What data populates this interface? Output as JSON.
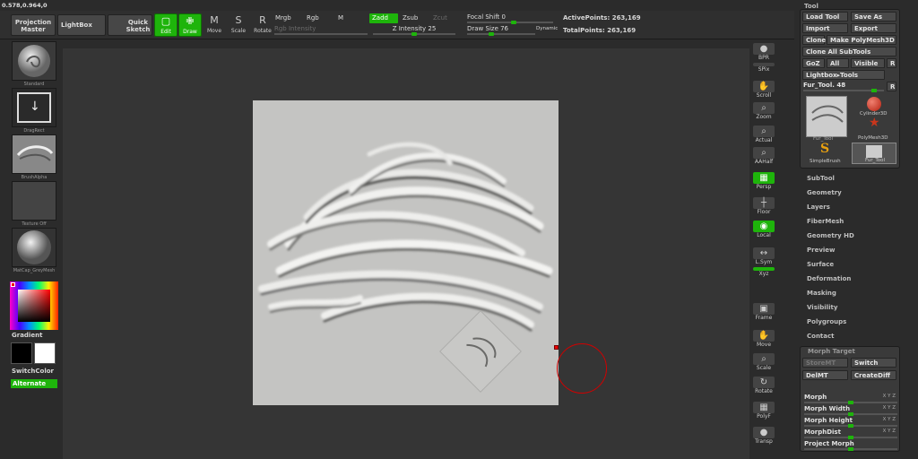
{
  "coords": "0.578,0.964,0",
  "topbar": {
    "projection_master": "Projection Master",
    "lightbox": "LightBox",
    "quick_sketch": "Quick Sketch",
    "tools": [
      {
        "id": "edit",
        "label": "Edit",
        "icon": "▢",
        "active": true
      },
      {
        "id": "draw",
        "label": "Draw",
        "icon": "✙",
        "active": true
      },
      {
        "id": "move",
        "label": "Move",
        "icon": "M",
        "active": false
      },
      {
        "id": "scale",
        "label": "Scale",
        "icon": "S",
        "active": false
      },
      {
        "id": "rotate",
        "label": "Rotate",
        "icon": "R",
        "active": false
      }
    ],
    "mrgb": "Mrgb",
    "rgb": "Rgb",
    "m": "M",
    "rgb_intensity": "Rgb Intensity",
    "zadd": "Zadd",
    "zsub": "Zsub",
    "zcut": "Zcut",
    "z_intensity": "Z Intensity 25",
    "z_intensity_value": 0.25,
    "focal_shift": "Focal Shift 0",
    "focal_shift_value": 0.5,
    "draw_size": "Draw Size 76",
    "draw_size_value": 0.25,
    "dynamic": "Dynamic",
    "active_points": "ActivePoints: 263,169",
    "total_points": "TotalPoints: 263,169"
  },
  "left": {
    "standard": "Standard",
    "dragrect": "DragRect",
    "brushalpha": "BrushAlpha",
    "texture_off": "Texture Off",
    "matcap": "MatCap_GreyMesh",
    "gradient": "Gradient",
    "switch_color": "SwitchColor",
    "alternate": "Alternate"
  },
  "right_shelf": [
    {
      "id": "bpr",
      "label": "BPR",
      "icon": "●",
      "active": false
    },
    {
      "id": "spix",
      "label": "SPix",
      "icon": "",
      "active": false
    },
    {
      "id": "scroll",
      "label": "Scroll",
      "icon": "✋",
      "active": false
    },
    {
      "id": "zoom",
      "label": "Zoom",
      "icon": "⌕",
      "active": false
    },
    {
      "id": "actual",
      "label": "Actual",
      "icon": "⌕",
      "active": false
    },
    {
      "id": "aahalf",
      "label": "AAHalf",
      "icon": "⌕",
      "active": false
    },
    {
      "id": "persp",
      "label": "Persp",
      "icon": "▦",
      "active": true
    },
    {
      "id": "floor",
      "label": "Floor",
      "icon": "┼",
      "active": false
    },
    {
      "id": "local",
      "label": "Local",
      "icon": "◉",
      "active": true
    },
    {
      "id": "lsym",
      "label": "L.Sym",
      "icon": "↔",
      "active": false
    },
    {
      "id": "xyz",
      "label": "Xyz",
      "icon": "",
      "active": true
    },
    {
      "id": "frame",
      "label": "Frame",
      "icon": "▣",
      "active": false
    },
    {
      "id": "move",
      "label": "Move",
      "icon": "✋",
      "active": false
    },
    {
      "id": "scale",
      "label": "Scale",
      "icon": "⌕",
      "active": false
    },
    {
      "id": "rotate",
      "label": "Rotate",
      "icon": "↻",
      "active": false
    },
    {
      "id": "polyf",
      "label": "PolyF",
      "icon": "▦",
      "active": false
    },
    {
      "id": "transp",
      "label": "Transp",
      "icon": "●",
      "active": false
    }
  ],
  "tool_palette": {
    "title": "Tool",
    "load_tool": "Load Tool",
    "save_as": "Save As",
    "import": "Import",
    "export": "Export",
    "clone": "Clone",
    "make_polymesh": "Make PolyMesh3D",
    "clone_all": "Clone All SubTools",
    "goz": "GoZ",
    "all": "All",
    "visible": "Visible",
    "r": "R",
    "lightbox_tools": "Lightbox▸Tools",
    "fur_tool_slider": "Fur_Tool. 48",
    "fur_tool_value": 0.88,
    "thumbs": {
      "fur_tool": "Fur_Tool",
      "cylinder3d": "Cylinder3D",
      "polymesh3d": "PolyMesh3D",
      "simplebrush": "SimpleBrush",
      "fur_tool2": "Fur_Tool"
    }
  },
  "menu": [
    "SubTool",
    "Geometry",
    "Layers",
    "FiberMesh",
    "Geometry HD",
    "Preview",
    "Surface",
    "Deformation",
    "Masking",
    "Visibility",
    "Polygroups",
    "Contact"
  ],
  "morph_target": {
    "title": "Morph Target",
    "storemt": "StoreMT",
    "switch": "Switch",
    "delmt": "DelMT",
    "creatediff": "CreateDiff",
    "morph": "Morph",
    "morph_width": "Morph Width",
    "morph_height": "Morph Height",
    "morphdist": "MorphDist",
    "project_morph": "Project Morph",
    "xyz": "X Y Z",
    "morph_value": 0.5,
    "morph_width_value": 0.5,
    "morph_height_value": 0.5,
    "morphdist_value": 0.5,
    "project_morph_value": 0.5
  },
  "colors": {
    "accent_green": "#1eb40b",
    "panel": "#3a3a3a",
    "canvas": "#353535"
  }
}
